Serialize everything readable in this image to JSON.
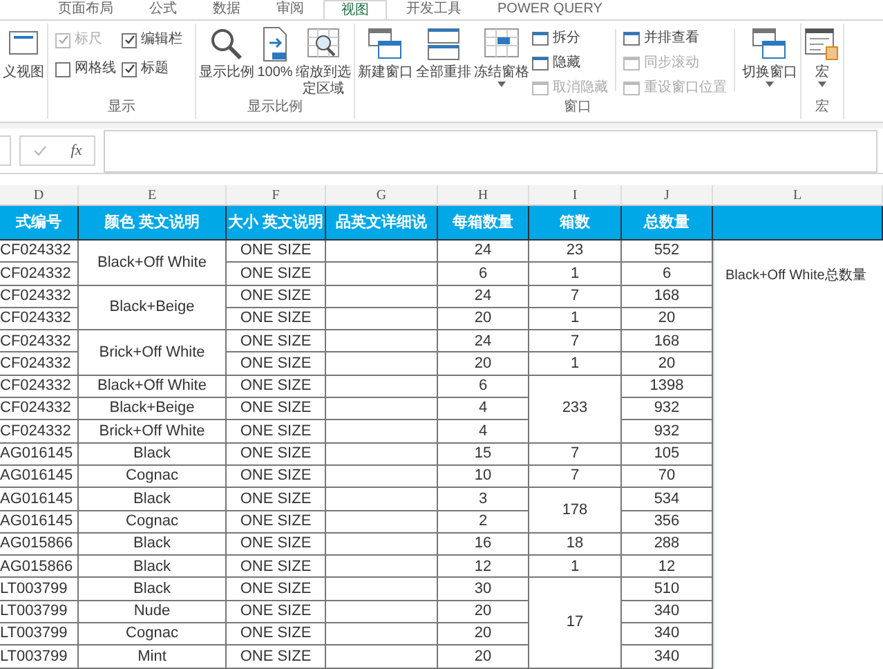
{
  "tabs": [
    {
      "label": "页面布局",
      "selected": false
    },
    {
      "label": "公式",
      "selected": false
    },
    {
      "label": "数据",
      "selected": false
    },
    {
      "label": "审阅",
      "selected": false
    },
    {
      "label": "视图",
      "selected": true
    },
    {
      "label": "开发工具",
      "selected": false
    },
    {
      "label": "POWER QUERY",
      "selected": false
    }
  ],
  "ribbon": {
    "groups": [
      {
        "kind": "views",
        "items": [
          {
            "label": "义视图",
            "dropdown": false
          }
        ]
      },
      {
        "kind": "checks",
        "label": "显示",
        "items": [
          {
            "label": "标尺",
            "checked": true,
            "disabled": true
          },
          {
            "label": "编辑栏",
            "checked": true,
            "disabled": false
          },
          {
            "label": "网格线",
            "checked": false,
            "disabled": false
          },
          {
            "label": "标题",
            "checked": true,
            "disabled": false
          }
        ]
      },
      {
        "kind": "zoom",
        "label": "显示比例",
        "items": [
          {
            "label": "显示比例",
            "dropdown": false
          },
          {
            "label": "100%",
            "dropdown": false
          },
          {
            "label": "缩放到选定区域",
            "dropdown": false
          }
        ]
      },
      {
        "kind": "window",
        "label": "窗口",
        "items": [
          {
            "label": "新建窗口",
            "dropdown": false
          },
          {
            "label": "全部重排",
            "dropdown": false
          },
          {
            "label": "冻结窗格",
            "dropdown": true
          }
        ],
        "small_left": [
          {
            "label": "拆分",
            "disabled": false
          },
          {
            "label": "隐藏",
            "disabled": false
          },
          {
            "label": "取消隐藏",
            "disabled": true
          }
        ],
        "small_right": [
          {
            "label": "并排查看",
            "disabled": false
          },
          {
            "label": "同步滚动",
            "disabled": true
          },
          {
            "label": "重设窗口位置",
            "disabled": true
          }
        ],
        "switch": {
          "label": "切换窗口",
          "dropdown": true
        }
      },
      {
        "kind": "macro",
        "label": "宏",
        "items": [
          {
            "label": "宏",
            "dropdown": true
          }
        ]
      }
    ]
  },
  "formula_bar": {
    "function_button": "fx"
  },
  "table": {
    "columns": [
      "D",
      "E",
      "F",
      "G",
      "H",
      "I",
      "J",
      "L"
    ],
    "headers": [
      "式编号",
      "颜色 英文说明",
      "大小 英文说明",
      "品英文详细说",
      "每箱数量",
      "箱数",
      "总数量"
    ],
    "note": "Black+Off White总数量",
    "rows": [
      {
        "style": "CF024332",
        "variant": "Black+Off White",
        "size": "ONE SIZE",
        "per_box": "24",
        "boxes": "23",
        "total": "552"
      },
      {
        "style": "CF024332",
        "size": "ONE SIZE",
        "per_box": "6",
        "boxes": "1",
        "total": "6"
      },
      {
        "style": "CF024332",
        "variant": "Black+Beige",
        "size": "ONE SIZE",
        "per_box": "24",
        "boxes": "7",
        "total": "168"
      },
      {
        "style": "CF024332",
        "size": "ONE SIZE",
        "per_box": "20",
        "boxes": "1",
        "total": "20"
      },
      {
        "style": "CF024332",
        "variant": "Brick+Off White",
        "size": "ONE SIZE",
        "per_box": "24",
        "boxes": "7",
        "total": "168"
      },
      {
        "style": "CF024332",
        "size": "ONE SIZE",
        "per_box": "20",
        "boxes": "1",
        "total": "20"
      },
      {
        "style": "CF024332",
        "variant": "Black+Off White",
        "size": "ONE SIZE",
        "per_box": "6",
        "boxes": "233",
        "total": "1398"
      },
      {
        "style": "CF024332",
        "variant": "Black+Beige",
        "size": "ONE SIZE",
        "per_box": "4",
        "total": "932"
      },
      {
        "style": "CF024332",
        "variant": "Brick+Off White",
        "size": "ONE SIZE",
        "per_box": "4",
        "total": "932"
      },
      {
        "style": "AG016145",
        "variant": "Black",
        "size": "ONE SIZE",
        "per_box": "15",
        "boxes": "7",
        "total": "105"
      },
      {
        "style": "AG016145",
        "variant": "Cognac",
        "size": "ONE SIZE",
        "per_box": "10",
        "boxes": "7",
        "total": "70"
      },
      {
        "style": "AG016145",
        "variant": "Black",
        "size": "ONE SIZE",
        "per_box": "3",
        "boxes": "178",
        "total": "534"
      },
      {
        "style": "AG016145",
        "variant": "Cognac",
        "size": "ONE SIZE",
        "per_box": "2",
        "total": "356"
      },
      {
        "style": "AG015866",
        "variant": "Black",
        "size": "ONE SIZE",
        "per_box": "16",
        "boxes": "18",
        "total": "288"
      },
      {
        "style": "AG015866",
        "variant": "Black",
        "size": "ONE SIZE",
        "per_box": "12",
        "boxes": "1",
        "total": "12"
      },
      {
        "style": "LT003799",
        "variant": "Black",
        "size": "ONE SIZE",
        "per_box": "30",
        "boxes": "17",
        "total": "510"
      },
      {
        "style": "LT003799",
        "variant": "Nude",
        "size": "ONE SIZE",
        "per_box": "20",
        "total": "340"
      },
      {
        "style": "LT003799",
        "variant": "Cognac",
        "size": "ONE SIZE",
        "per_box": "20",
        "total": "340"
      },
      {
        "style": "LT003799",
        "variant": "Mint",
        "size": "ONE SIZE",
        "per_box": "20",
        "total": "340"
      }
    ]
  }
}
